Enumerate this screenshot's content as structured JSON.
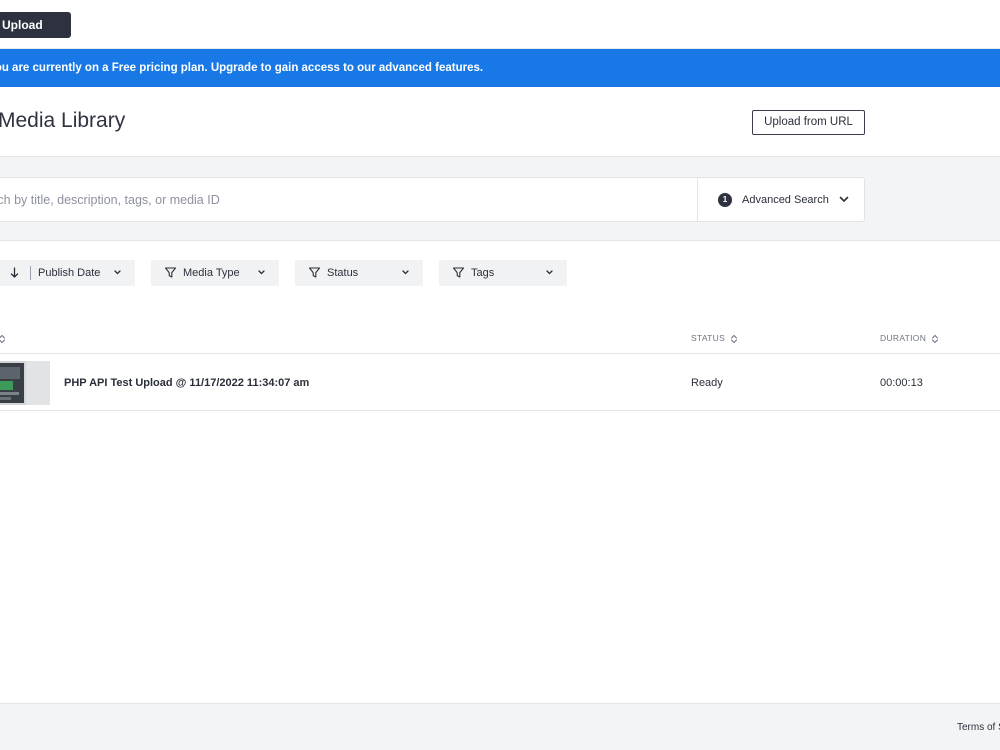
{
  "topbar": {
    "upload_label": "Upload"
  },
  "banner": {
    "text": "You are currently on a Free pricing plan. Upgrade to gain access to our advanced features."
  },
  "header": {
    "title": "Media Library",
    "upload_url_label": "Upload from URL"
  },
  "search": {
    "placeholder": "Search by title, description, tags, or media ID",
    "advanced_count": "1",
    "advanced_label": "Advanced Search"
  },
  "filters": {
    "sort_label": "Publish Date",
    "media_type_label": "Media Type",
    "status_label": "Status",
    "tags_label": "Tags"
  },
  "table": {
    "columns": {
      "status": "STATUS",
      "duration": "DURATION"
    },
    "rows": [
      {
        "title": "PHP API Test Upload @ 11/17/2022 11:34:07 am",
        "status": "Ready",
        "duration": "00:00:13"
      }
    ]
  },
  "footer": {
    "terms_label": "Terms of Service"
  }
}
